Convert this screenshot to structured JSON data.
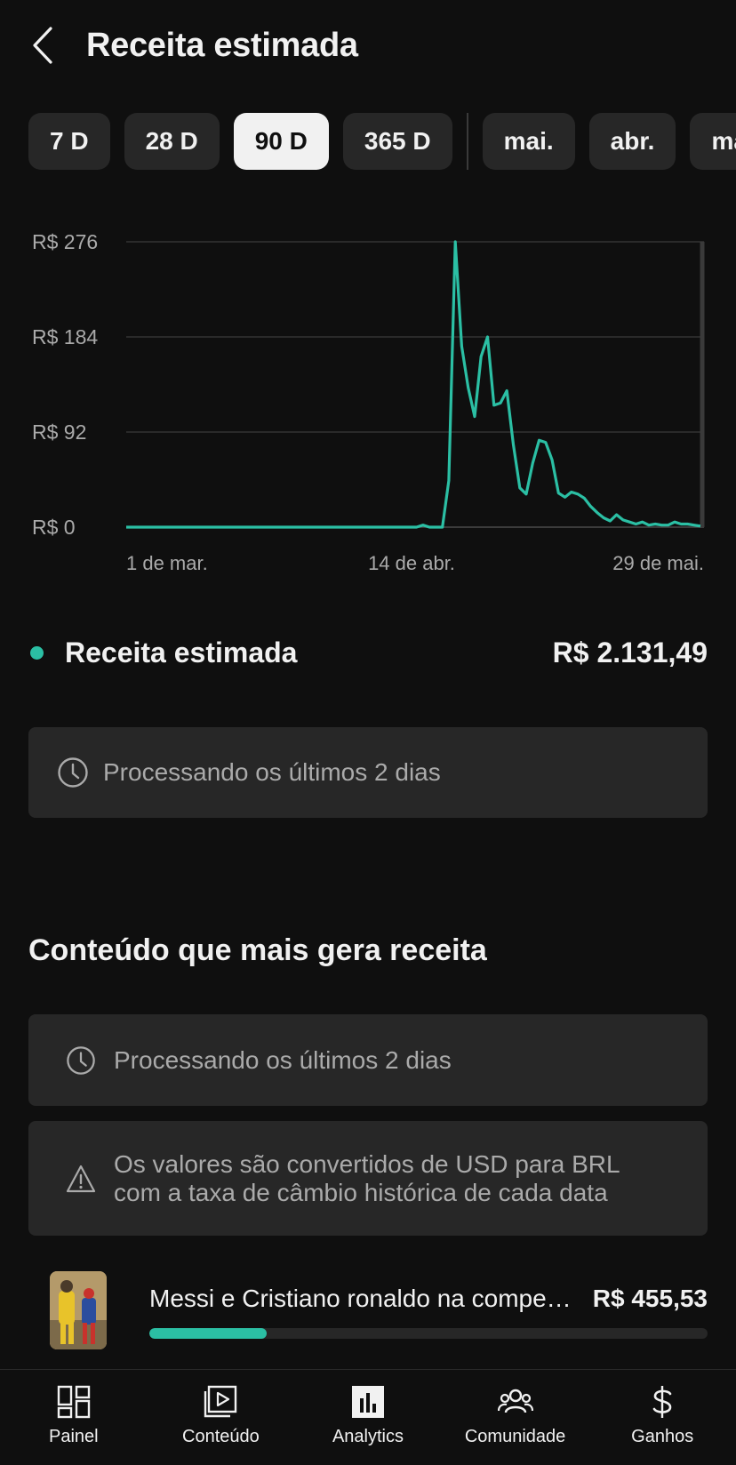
{
  "header": {
    "title": "Receita estimada",
    "back_icon": "chevron-left-icon"
  },
  "chips": [
    {
      "label": "7 D",
      "active": false
    },
    {
      "label": "28 D",
      "active": false
    },
    {
      "label": "90 D",
      "active": true
    },
    {
      "label": "365 D",
      "active": false
    },
    {
      "label": "mai.",
      "active": false
    },
    {
      "label": "abr.",
      "active": false
    },
    {
      "label": "mar.",
      "active": false
    }
  ],
  "chart_data": {
    "type": "line",
    "y_ticks": [
      "R$ 276",
      "R$ 184",
      "R$ 92",
      "R$ 0"
    ],
    "x_ticks": [
      "1 de mar.",
      "14 de abr.",
      "29 de mai."
    ],
    "ylim": [
      0,
      276
    ],
    "grid": true,
    "color": "#2bbfa4",
    "series": [
      {
        "values": [
          0,
          0,
          0,
          0,
          0,
          0,
          0,
          0,
          0,
          0,
          0,
          0,
          0,
          0,
          0,
          0,
          0,
          0,
          0,
          0,
          0,
          0,
          0,
          0,
          0,
          0,
          0,
          0,
          0,
          0,
          0,
          0,
          0,
          0,
          0,
          0,
          0,
          0,
          0,
          0,
          0,
          0,
          0,
          0,
          0,
          0,
          2,
          0,
          0,
          0,
          45,
          276,
          175,
          135,
          107,
          165,
          184,
          118,
          120,
          132,
          80,
          38,
          32,
          62,
          84,
          82,
          65,
          33,
          29,
          34,
          32,
          28,
          20,
          14,
          9,
          6,
          12,
          7,
          5,
          3,
          5,
          2,
          3,
          2,
          2,
          5,
          3,
          3,
          2,
          1
        ]
      }
    ]
  },
  "legend": {
    "label": "Receita estimada",
    "value": "R$ 2.131,49",
    "color": "#2bbfa4"
  },
  "notice_processing": {
    "text": "Processando os últimos 2 dias",
    "icon": "clock-icon"
  },
  "top_content": {
    "title": "Conteúdo que mais gera receita",
    "processing_text": "Processando os últimos 2 dias",
    "currency_line1": "Os valores são convertidos de USD para BRL",
    "currency_line2": "com a taxa de câmbio histórica de cada data",
    "items": [
      {
        "title": "Messi e Cristiano ronaldo na competição",
        "value": "R$ 455,53",
        "share": 0.21
      }
    ]
  },
  "nav": [
    {
      "label": "Painel",
      "icon": "dashboard-icon"
    },
    {
      "label": "Conteúdo",
      "icon": "content-icon"
    },
    {
      "label": "Analytics",
      "icon": "analytics-icon"
    },
    {
      "label": "Comunidade",
      "icon": "community-icon"
    },
    {
      "label": "Ganhos",
      "icon": "dollar-icon"
    }
  ]
}
